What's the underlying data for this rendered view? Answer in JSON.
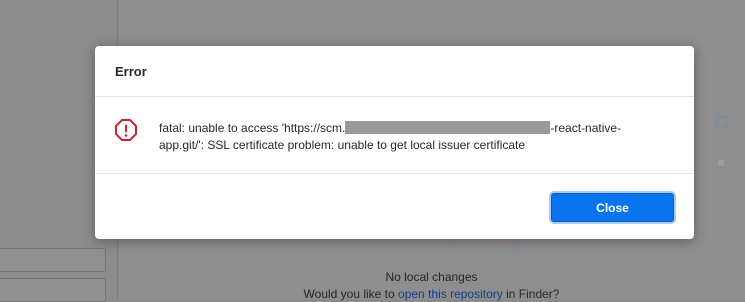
{
  "background": {
    "no_changes_text": "No local changes",
    "prompt_prefix": "Would you like to ",
    "prompt_link": "open this repository",
    "prompt_suffix": " in Finder?"
  },
  "dialog": {
    "title": "Error",
    "message_before": "fatal: unable to access 'https://scm.",
    "message_after": "-react-native-app.git/': SSL certificate problem: unable to get local issuer certificate",
    "icon": "alert-circle-icon",
    "close_label": "Close"
  },
  "colors": {
    "accent": "#0a74ee",
    "error": "#cb2431"
  }
}
